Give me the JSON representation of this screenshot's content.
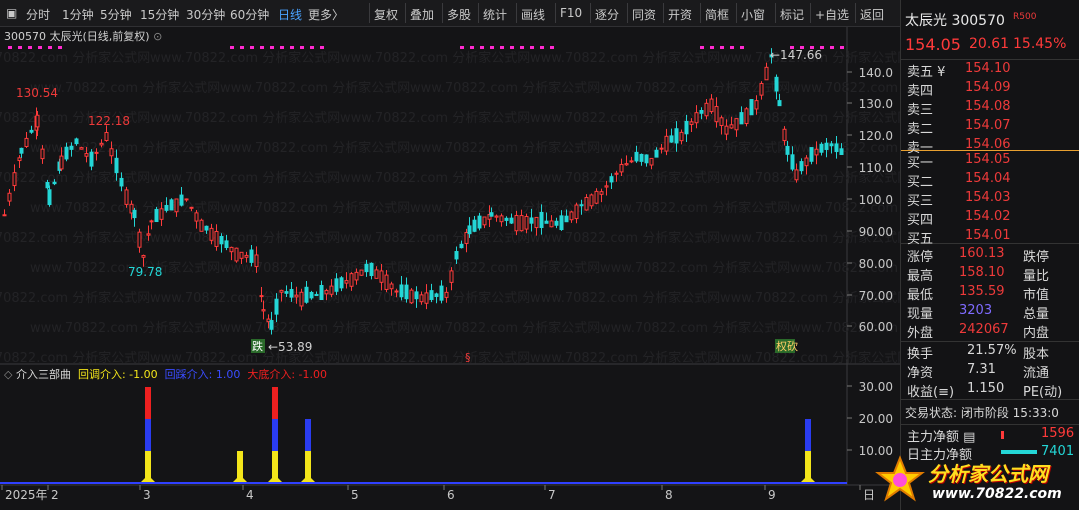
{
  "toolbar": {
    "items": [
      "分时",
      "1分钟",
      "5分钟",
      "15分钟",
      "30分钟",
      "60分钟",
      "日线",
      "更多〉"
    ],
    "tools": [
      "复权",
      "叠加",
      "多股",
      "统计",
      "画线",
      "F10",
      "逐分",
      "同资",
      "开资",
      "简框",
      "小窗",
      "标记",
      "+自选",
      "返回"
    ]
  },
  "chart": {
    "title": "300570 太辰光(日线,前复权)",
    "yticks": [
      "140.0",
      "130.0",
      "120.0",
      "110.0",
      "100.0",
      "90.00",
      "80.00",
      "70.00",
      "60.00"
    ],
    "annotations": [
      {
        "text": "130.54",
        "color": "#ee3a3a"
      },
      {
        "text": "122.18",
        "color": "#ee3a3a"
      },
      {
        "text": "79.78",
        "color": "#23d7d7"
      },
      {
        "text": "←53.89",
        "color": "#d0d0d0"
      },
      {
        "text": "←147.66",
        "color": "#d0d0d0"
      }
    ],
    "markers": [
      "跌",
      "§",
      "权砍"
    ]
  },
  "sub": {
    "name": "介入三部曲",
    "series": [
      {
        "label": "回调介入: -1.00",
        "color": "#f3e51a"
      },
      {
        "label": "回踩介入: 1.00",
        "color": "#2a3cf0"
      },
      {
        "label": "大底介入: -1.00",
        "color": "#ee2020"
      }
    ],
    "yticks": [
      "30.00",
      "20.00",
      "10.00"
    ]
  },
  "xaxis": [
    "2025年",
    "2",
    "3",
    "4",
    "5",
    "6",
    "7",
    "8",
    "9",
    "日"
  ],
  "panel": {
    "name": "太辰光",
    "code": "300570",
    "badge": "R500",
    "price": "154.05",
    "change": "20.61",
    "pct": "15.45%",
    "asks": [
      {
        "l": "卖五 ¥",
        "p": "154.10"
      },
      {
        "l": "卖四",
        "p": "154.09"
      },
      {
        "l": "卖三",
        "p": "154.08"
      },
      {
        "l": "卖二",
        "p": "154.07"
      },
      {
        "l": "卖一",
        "p": "154.06"
      }
    ],
    "bids": [
      {
        "l": "买一",
        "p": "154.05"
      },
      {
        "l": "买二",
        "p": "154.04"
      },
      {
        "l": "买三",
        "p": "154.03"
      },
      {
        "l": "买四",
        "p": "154.02"
      },
      {
        "l": "买五",
        "p": "154.01"
      }
    ],
    "stats": [
      {
        "a": "涨停",
        "b": "160.13",
        "c": "跌停"
      },
      {
        "a": "最高",
        "b": "158.10",
        "c": "量比"
      },
      {
        "a": "最低",
        "b": "135.59",
        "c": "市值"
      },
      {
        "a": "现量",
        "b": "3203",
        "c": "总量"
      },
      {
        "a": "外盘",
        "b": "242067",
        "c": "内盘"
      }
    ],
    "stats2": [
      {
        "a": "换手",
        "b": "21.57%",
        "c": "股本"
      },
      {
        "a": "净资",
        "b": "7.31",
        "c": "流通"
      },
      {
        "a": "收益(≡)",
        "b": "1.150",
        "c": "PE(动)"
      }
    ],
    "status": "交易状态: 闭市阶段 15:33:0",
    "flow1": "主力净额",
    "flow1v": "1596",
    "flow2": "日主力净额",
    "flow2v": "7401"
  },
  "watermark": {
    "line1": "分析家公式网",
    "line2": "www.70822.com"
  },
  "bgmark": "www.70822.com 分析家公式网"
}
